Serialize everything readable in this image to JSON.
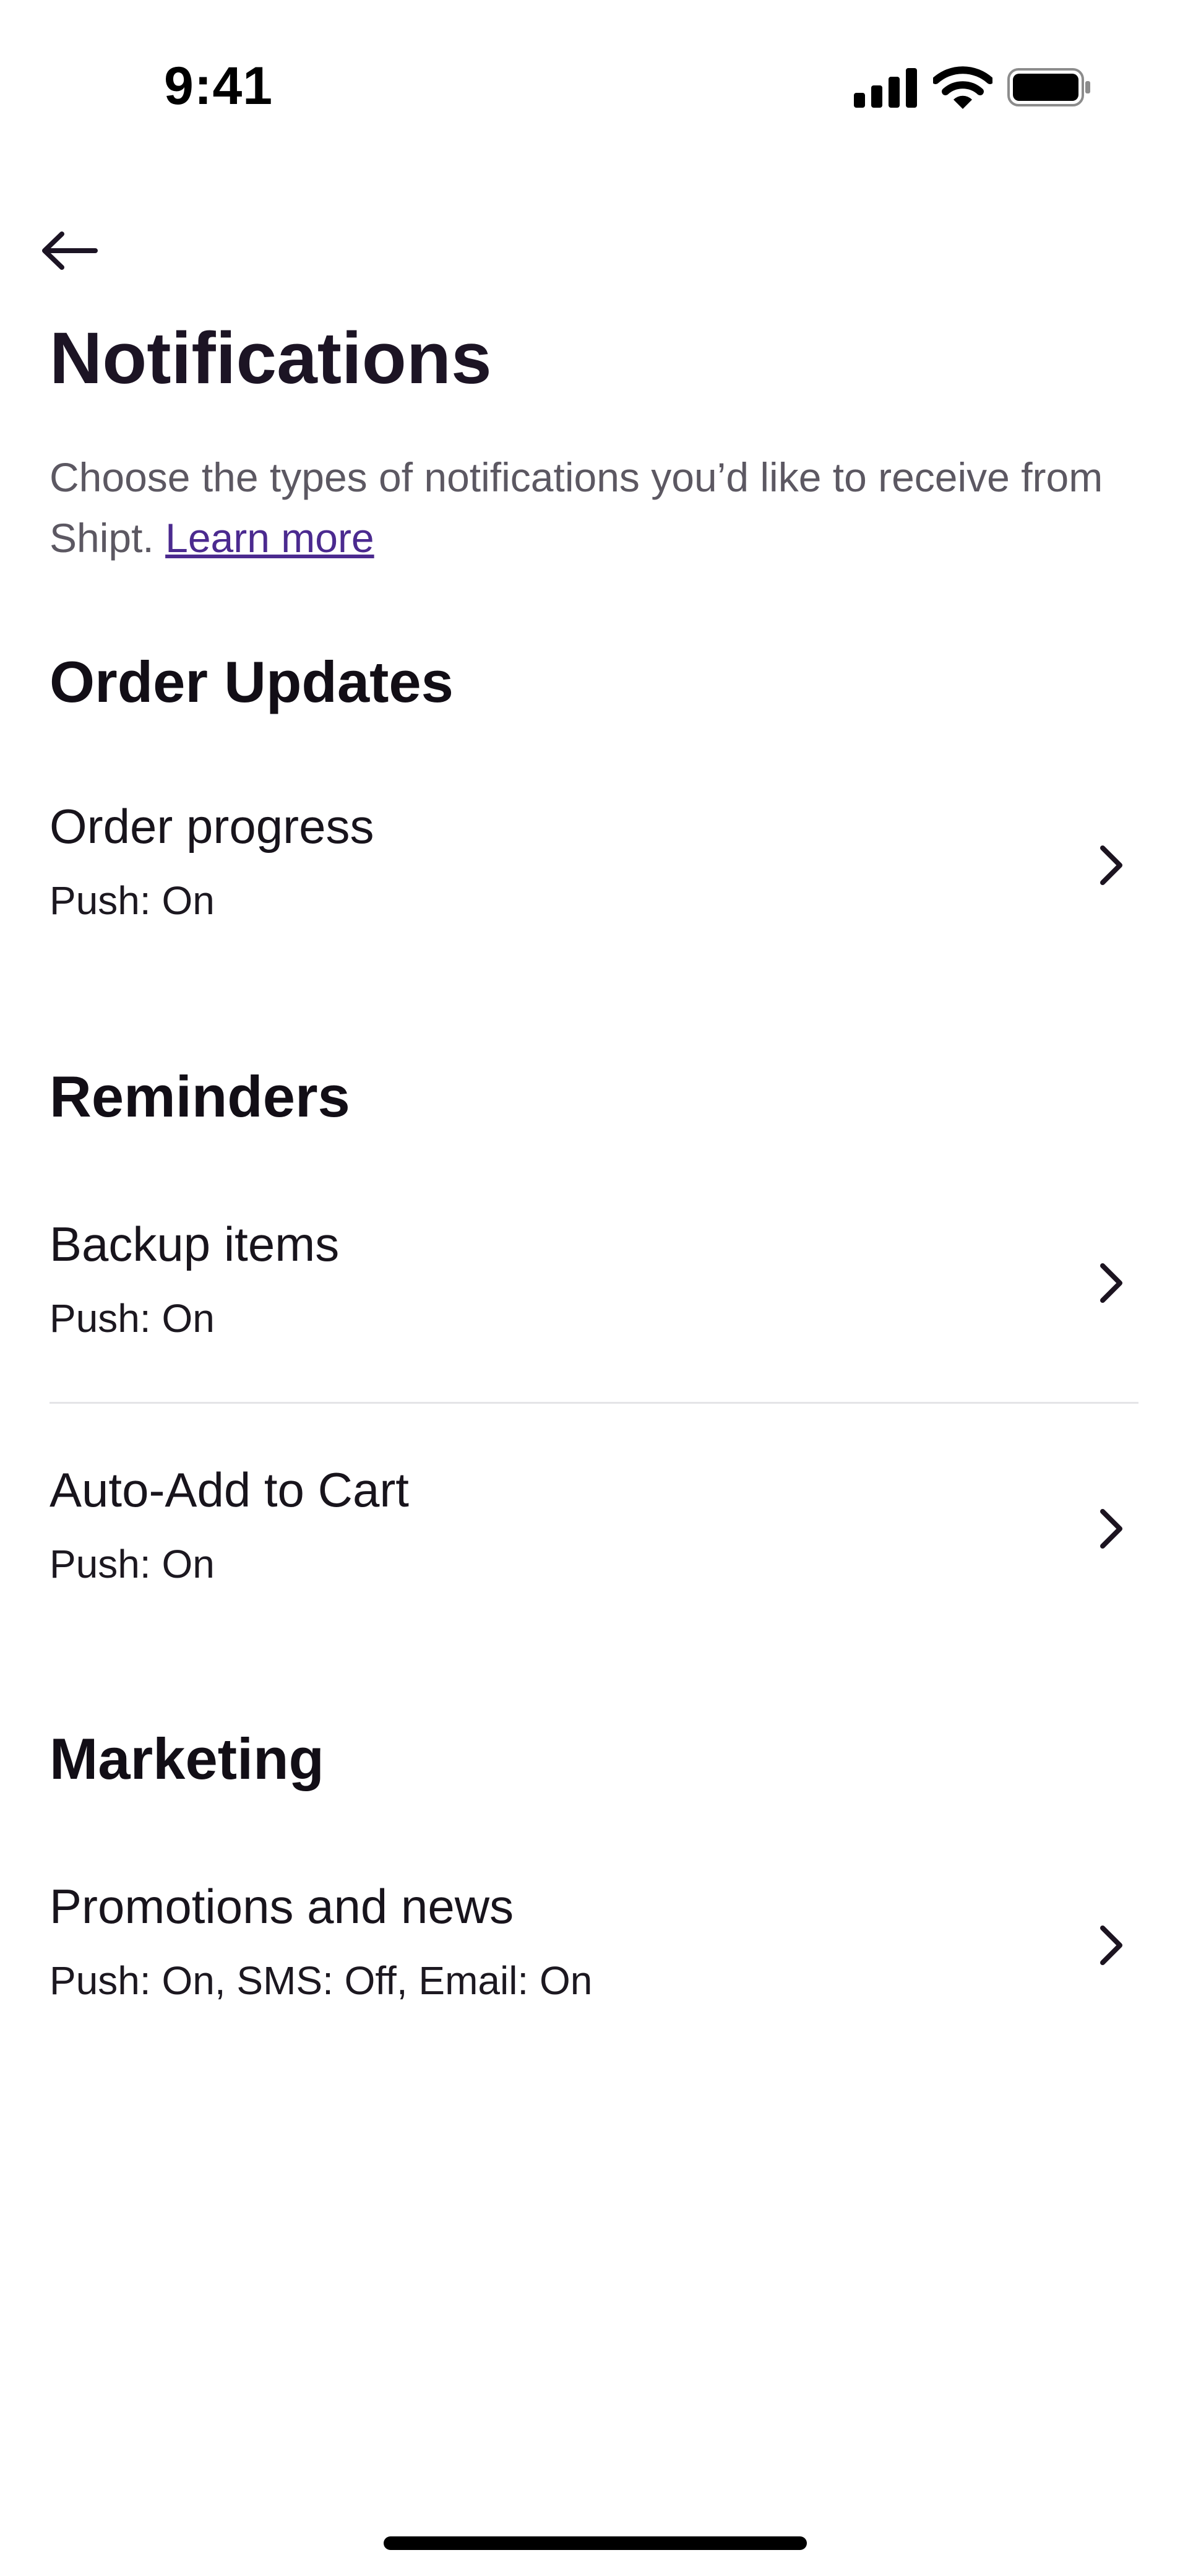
{
  "status_bar": {
    "time": "9:41",
    "icons": [
      "signal-icon",
      "wifi-icon",
      "battery-icon"
    ]
  },
  "header": {
    "back_icon": "arrow-left-icon",
    "title": "Notifications"
  },
  "intro": {
    "text": "Choose the types of notifications you’d like to receive from Shipt.",
    "link_label": "Learn more"
  },
  "sections": [
    {
      "title": "Order Updates",
      "items": [
        {
          "title": "Order progress",
          "status": "Push: On"
        }
      ]
    },
    {
      "title": "Reminders",
      "items": [
        {
          "title": "Backup items",
          "status": "Push: On"
        },
        {
          "title": "Auto-Add to Cart",
          "status": "Push: On"
        }
      ]
    },
    {
      "title": "Marketing",
      "items": [
        {
          "title": "Promotions and news",
          "status": "Push: On, SMS: Off, Email: On"
        }
      ]
    }
  ],
  "colors": {
    "link": "#4b2a8f",
    "text_primary": "#1c1424",
    "text_secondary": "#5c5862",
    "divider": "#e4e4e7"
  }
}
